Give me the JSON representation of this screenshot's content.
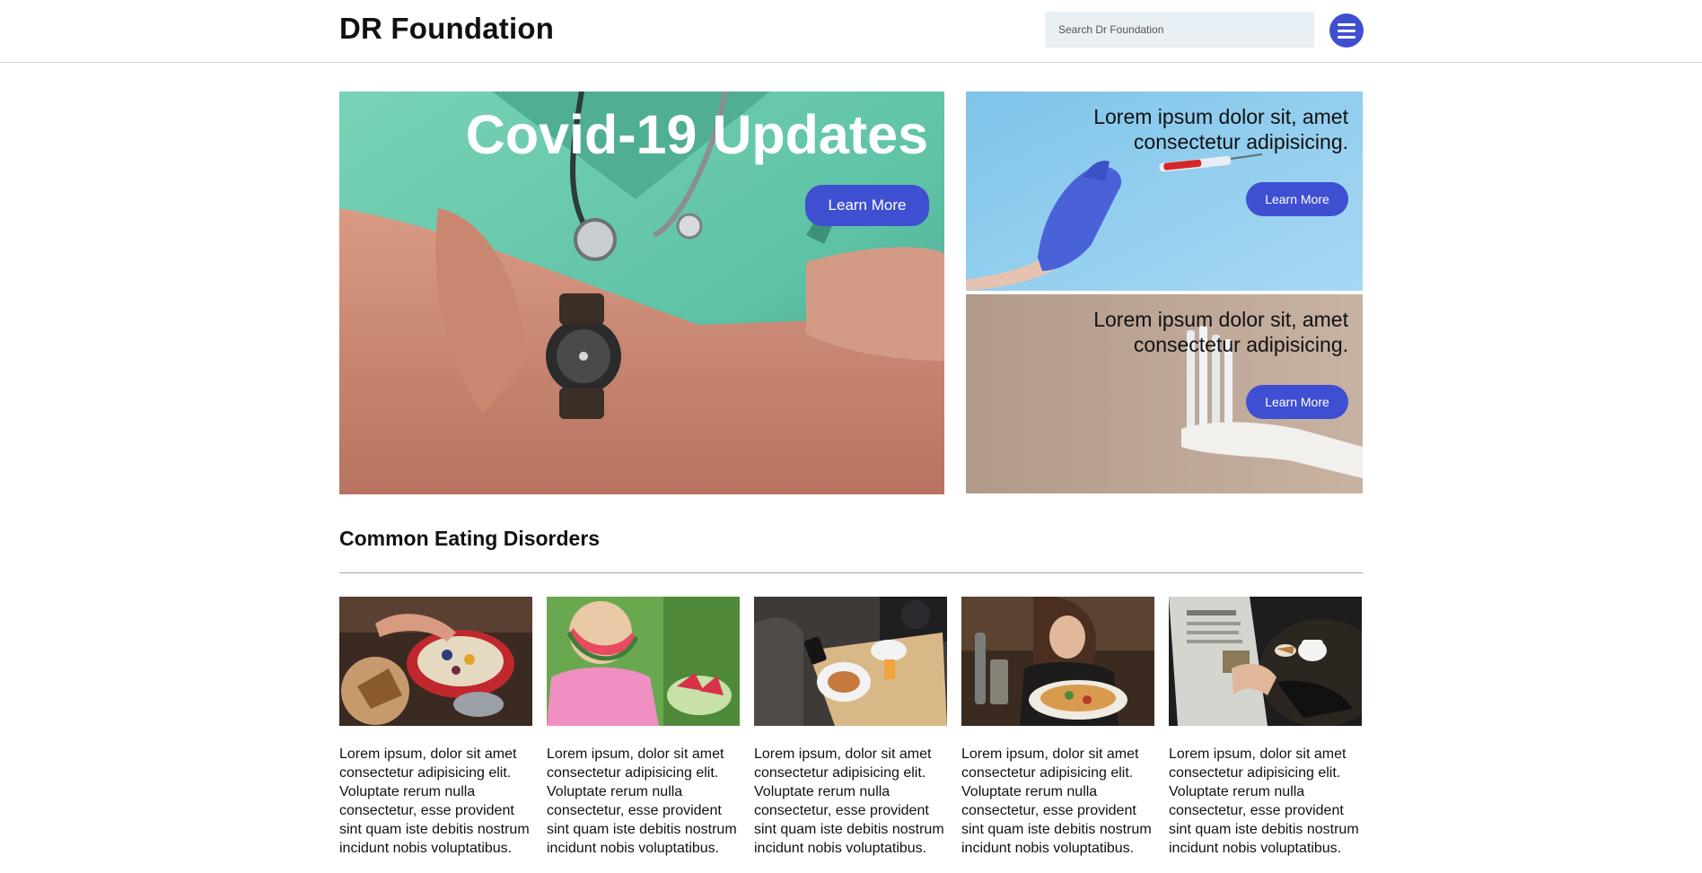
{
  "header": {
    "brand": "DR Foundation",
    "search_placeholder": "Search Dr Foundation"
  },
  "hero": {
    "main": {
      "title": "Covid-19 Updates",
      "button": "Learn More"
    },
    "side": [
      {
        "text": "Lorem ipsum dolor sit, amet consectetur adipisicing.",
        "button": "Learn More"
      },
      {
        "text": "Lorem ipsum dolor sit, amet consectetur adipisicing.",
        "button": "Learn More"
      }
    ]
  },
  "section": {
    "title": "Common Eating Disorders",
    "cards": [
      {
        "text": "Lorem ipsum, dolor sit amet consectetur adipisicing elit. Voluptate rerum nulla consectetur, esse provident sint quam iste debitis nostrum incidunt nobis voluptatibus."
      },
      {
        "text": "Lorem ipsum, dolor sit amet consectetur adipisicing elit. Voluptate rerum nulla consectetur, esse provident sint quam iste debitis nostrum incidunt nobis voluptatibus."
      },
      {
        "text": "Lorem ipsum, dolor sit amet consectetur adipisicing elit. Voluptate rerum nulla consectetur, esse provident sint quam iste debitis nostrum incidunt nobis voluptatibus."
      },
      {
        "text": "Lorem ipsum, dolor sit amet consectetur adipisicing elit. Voluptate rerum nulla consectetur, esse provident sint quam iste debitis nostrum incidunt nobis voluptatibus."
      },
      {
        "text": "Lorem ipsum, dolor sit amet consectetur adipisicing elit. Voluptate rerum nulla consectetur, esse provident sint quam iste debitis nostrum incidunt nobis voluptatibus."
      }
    ]
  },
  "colors": {
    "accent": "#3f4fd1",
    "search_bg": "#e8eff5"
  },
  "icons": {
    "menu": "hamburger-menu-icon"
  }
}
